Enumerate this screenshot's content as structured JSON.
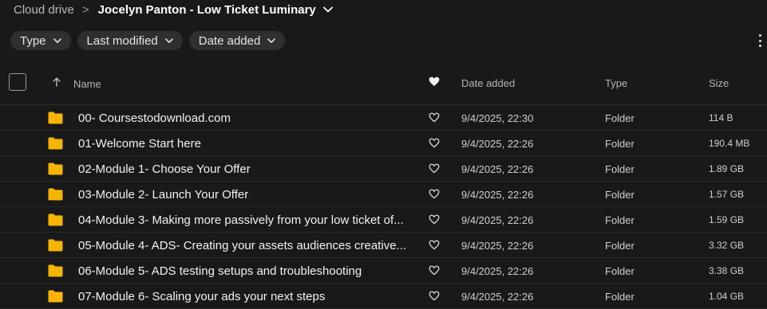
{
  "breadcrumb": {
    "root": "Cloud drive",
    "separator": ">",
    "current": "Jocelyn Panton - Low Ticket Luminary"
  },
  "filters": [
    {
      "label": "Type"
    },
    {
      "label": "Last modified"
    },
    {
      "label": "Date added"
    }
  ],
  "columns": {
    "name": "Name",
    "date_added": "Date added",
    "type": "Type",
    "size": "Size"
  },
  "icons": {
    "folder_color": "#f7b500",
    "sort": "arrow-up-icon",
    "favorite": "heart-icon"
  },
  "rows": [
    {
      "name": "00- Coursestodownload.com",
      "date": "9/4/2025, 22:30",
      "type": "Folder",
      "size": "114 B"
    },
    {
      "name": "01-Welcome Start here",
      "date": "9/4/2025, 22:26",
      "type": "Folder",
      "size": "190.4 MB"
    },
    {
      "name": "02-Module 1- Choose Your Offer",
      "date": "9/4/2025, 22:26",
      "type": "Folder",
      "size": "1.89 GB"
    },
    {
      "name": "03-Module 2- Launch Your Offer",
      "date": "9/4/2025, 22:26",
      "type": "Folder",
      "size": "1.57 GB"
    },
    {
      "name": "04-Module 3- Making more passively from your low ticket of...",
      "date": "9/4/2025, 22:26",
      "type": "Folder",
      "size": "1.59 GB"
    },
    {
      "name": "05-Module 4- ADS- Creating your assets audiences creative...",
      "date": "9/4/2025, 22:26",
      "type": "Folder",
      "size": "3.32 GB"
    },
    {
      "name": "06-Module 5- ADS testing setups and troubleshooting",
      "date": "9/4/2025, 22:26",
      "type": "Folder",
      "size": "3.38 GB"
    },
    {
      "name": "07-Module 6- Scaling your ads your next steps",
      "date": "9/4/2025, 22:26",
      "type": "Folder",
      "size": "1.04 GB"
    }
  ]
}
